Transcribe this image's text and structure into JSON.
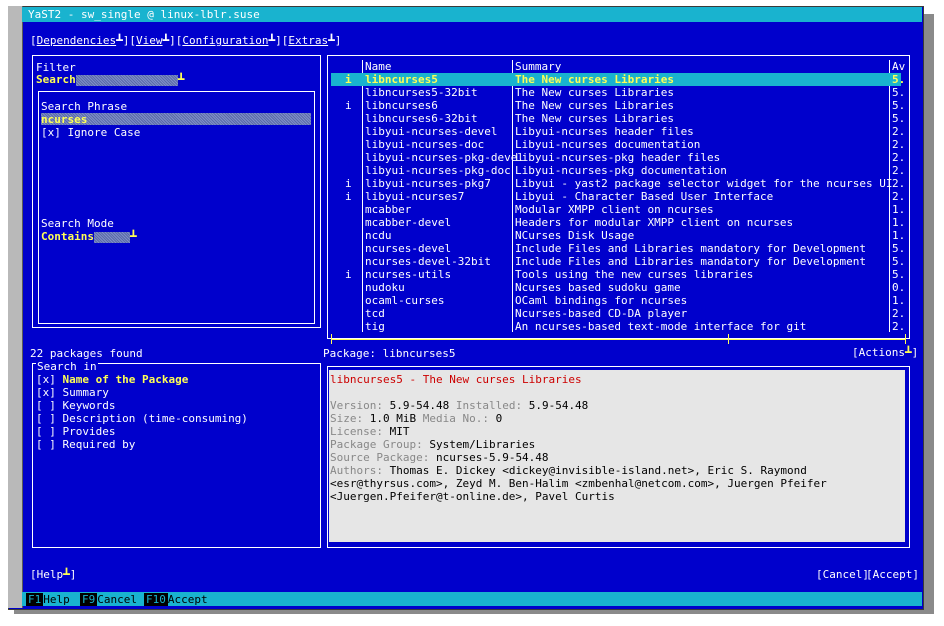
{
  "window": {
    "title": "YaST2 - sw_single @ linux-lblr.suse"
  },
  "menubar": [
    "Dependencies",
    "View",
    "Configuration",
    "Extras"
  ],
  "filter": {
    "frame_label": "Filter",
    "combo_label": "Search",
    "search_phrase_label": "Search Phrase",
    "search_phrase_value": "ncurses",
    "ignore_case_box": "[x]",
    "ignore_case_label": "Ignore Case",
    "search_mode_label": "Search Mode",
    "search_mode_value": "Contains"
  },
  "found_text": "22 packages found",
  "search_in": {
    "label": "Search in",
    "items": [
      {
        "box": "[x]",
        "label": "Name of the Package"
      },
      {
        "box": "[x]",
        "label": "Summary"
      },
      {
        "box": "[ ]",
        "label": "Keywords"
      },
      {
        "box": "[ ]",
        "label": "Description (time-consuming)"
      },
      {
        "box": "[ ]",
        "label": "Provides"
      },
      {
        "box": "[ ]",
        "label": "Required by"
      }
    ]
  },
  "table": {
    "headers": {
      "name": "Name",
      "summary": "Summary",
      "avail": "Av"
    },
    "rows": [
      {
        "status": "i",
        "name": "libncurses5",
        "summary": "The New curses Libraries",
        "av": "5."
      },
      {
        "status": "",
        "name": "libncurses5-32bit",
        "summary": "The New curses Libraries",
        "av": "5."
      },
      {
        "status": "i",
        "name": "libncurses6",
        "summary": "The New curses Libraries",
        "av": "5."
      },
      {
        "status": "",
        "name": "libncurses6-32bit",
        "summary": "The New curses Libraries",
        "av": "5."
      },
      {
        "status": "",
        "name": "libyui-ncurses-devel",
        "summary": "Libyui-ncurses header files",
        "av": "2."
      },
      {
        "status": "",
        "name": "libyui-ncurses-doc",
        "summary": "Libyui-ncurses documentation",
        "av": "2."
      },
      {
        "status": "",
        "name": "libyui-ncurses-pkg-devel",
        "summary": "Libyui-ncurses-pkg header files",
        "av": "2."
      },
      {
        "status": "",
        "name": "libyui-ncurses-pkg-doc",
        "summary": "Libyui-ncurses-pkg documentation",
        "av": "2."
      },
      {
        "status": "i",
        "name": "libyui-ncurses-pkg7",
        "summary": "Libyui - yast2 package selector widget for the ncurses UI",
        "av": "2."
      },
      {
        "status": "i",
        "name": "libyui-ncurses7",
        "summary": "Libyui - Character Based User Interface",
        "av": "2."
      },
      {
        "status": "",
        "name": "mcabber",
        "summary": "Modular XMPP client on ncurses",
        "av": "1."
      },
      {
        "status": "",
        "name": "mcabber-devel",
        "summary": "Headers for modular XMPP client on ncurses",
        "av": "1."
      },
      {
        "status": "",
        "name": "ncdu",
        "summary": "NCurses Disk Usage",
        "av": "1."
      },
      {
        "status": "",
        "name": "ncurses-devel",
        "summary": "Include Files and Libraries mandatory for Development",
        "av": "5."
      },
      {
        "status": "",
        "name": "ncurses-devel-32bit",
        "summary": "Include Files and Libraries mandatory for Development",
        "av": "5."
      },
      {
        "status": "i",
        "name": "ncurses-utils",
        "summary": "Tools using the new curses libraries",
        "av": "5."
      },
      {
        "status": "",
        "name": "nudoku",
        "summary": "Ncurses based sudoku game",
        "av": "0."
      },
      {
        "status": "",
        "name": "ocaml-curses",
        "summary": "OCaml bindings for ncurses",
        "av": "1."
      },
      {
        "status": "",
        "name": "tcd",
        "summary": "Ncurses-based CD-DA player",
        "av": "2."
      },
      {
        "status": "",
        "name": "tig",
        "summary": "An ncurses-based text-mode interface for git",
        "av": "2."
      }
    ]
  },
  "package_label": "Package: libncurses5",
  "actions_button": "[Actions",
  "details": {
    "title": "libncurses5 - The New curses Libraries",
    "version_label": "Version:",
    "version": "5.9-54.48",
    "installed_label": "Installed:",
    "installed": "5.9-54.48",
    "size_label": "Size:",
    "size": "1.0 MiB",
    "media_label": "Media No.:",
    "media": "0",
    "license_label": "License:",
    "license": "MIT",
    "group_label": "Package Group:",
    "group": "System/Libraries",
    "source_label": "Source Package:",
    "source": "ncurses-5.9-54.48",
    "authors_label": "Authors:",
    "authors_1": "Thomas E. Dickey <dickey@invisible-island.net>, Eric S. Raymond",
    "authors_2": "<esr@thyrsus.com>, Zeyd M. Ben-Halim <zmbenhal@netcom.com>, Juergen Pfeifer",
    "authors_3": "<Juergen.Pfeifer@t-online.de>, Pavel Curtis"
  },
  "buttons": {
    "help": "[Help",
    "cancel": "[Cancel]",
    "accept": "[Accept]"
  },
  "fkeys": [
    {
      "key": "F1",
      "label": "Help"
    },
    {
      "key": "F9",
      "label": "Cancel"
    },
    {
      "key": "F10",
      "label": "Accept"
    }
  ],
  "colors": {
    "background": "#0000cc",
    "accent": "#19b3cf",
    "highlight": "#ffff55",
    "details_bg": "#e6e6e6"
  }
}
